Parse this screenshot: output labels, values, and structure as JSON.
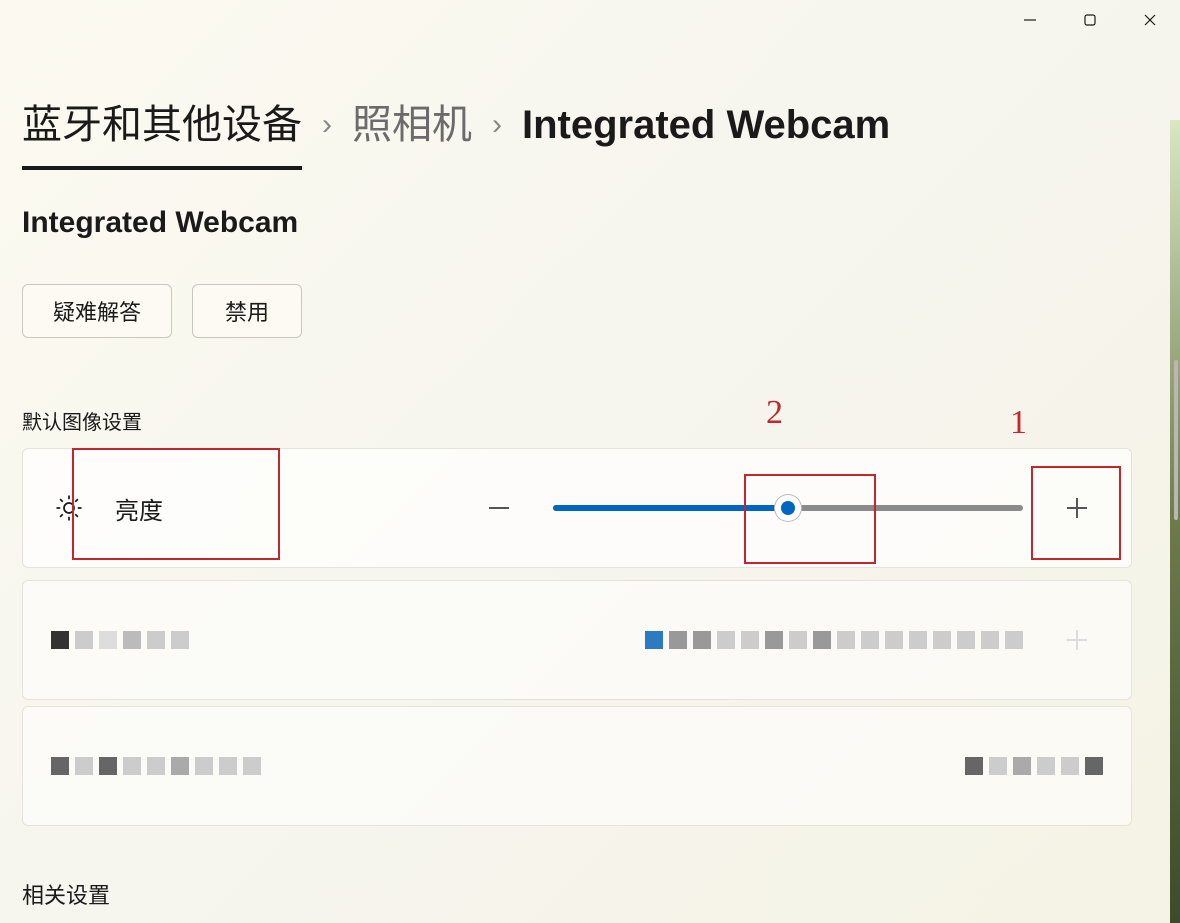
{
  "window": {
    "minimize_tooltip": "最小化",
    "maximize_tooltip": "最大化",
    "close_tooltip": "关闭"
  },
  "breadcrumb": {
    "level1": "蓝牙和其他设备",
    "level2": "照相机",
    "current": "Integrated Webcam"
  },
  "subtitle": "Integrated Webcam",
  "actions": {
    "troubleshoot": "疑难解答",
    "disable": "禁用"
  },
  "sections": {
    "default_image_settings": "默认图像设置",
    "related_settings": "相关设置"
  },
  "settings": {
    "brightness": {
      "label": "亮度",
      "decrease": "−",
      "increase": "＋",
      "value_percent": 50
    }
  },
  "annotations": {
    "number_1": "1",
    "number_2": "2"
  }
}
